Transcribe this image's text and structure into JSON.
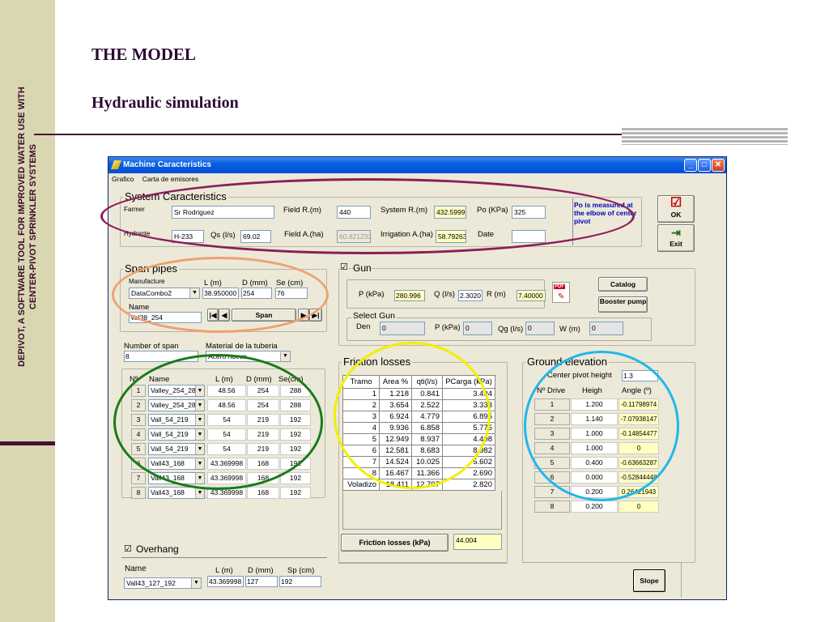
{
  "slide": {
    "side_text_line1": "DEPIVOT, A SOFTWARE TOOL FOR IMPROVED WATER USE WITH",
    "side_text_line2": "CENTER-PIVOT SPRINKLER SYSTEMS",
    "title": "THE MODEL",
    "subtitle": "Hydraulic simulation"
  },
  "window": {
    "title": "Machine Caracteristics",
    "menu": [
      "Grafico",
      "Carta de emisores"
    ],
    "buttons": {
      "minimize": "_",
      "maximize": "□",
      "close": "✕"
    }
  },
  "system": {
    "group_title": "System Caracteristics",
    "farmer_label": "Farmer",
    "farmer_value": "Sr Rodriguez",
    "hydrante_label": "Hydrante",
    "hydrante_value": "H-233",
    "field_r_label": "Field R.(m)",
    "field_r_value": "440",
    "system_r_label": "System R.(m)",
    "system_r_value": "432.5999",
    "po_label": "Po (KPa)",
    "po_value": "325",
    "qs_label": "Qs (l/s)",
    "qs_value": "69.02",
    "field_a_label": "Field A.(ha)",
    "field_a_value": "60.821233",
    "irrigation_label": "Irrigation A.(ha)",
    "irrigation_value": "58.79263",
    "date_label": "Date",
    "date_value": "",
    "note": "Po is measured at the elbow of center pivot"
  },
  "actions": {
    "ok": "OK",
    "exit": "Exit",
    "ok_icon": "checkbox-check-icon",
    "exit_icon": "exit-door-icon"
  },
  "span_pipes": {
    "group_title": "Span pipes",
    "manufacture_label": "Manufacture",
    "manufacture_value": "DataCombo2",
    "l_label": "L (m)",
    "l_value": "38.950000",
    "d_label": "D (mm)",
    "d_value": "254",
    "se_label": "Se (cm)",
    "se_value": "76",
    "name_label": "Name",
    "name_value": "Val38_254",
    "span_button": "Span",
    "nav_first": "|◀",
    "nav_prev": "◀",
    "nav_next": "▶",
    "nav_last": "▶|"
  },
  "spans": {
    "number_label": "Number of span",
    "number_value": "8",
    "material_label": "Material de la tuberia",
    "material_value": "Acero nuevo",
    "headers": [
      "Nº",
      "Name",
      "L (m)",
      "D (mm)",
      "Se(cm)"
    ],
    "rows": [
      {
        "n": "1",
        "name": "Valley_254_28",
        "l": "48.56",
        "d": "254",
        "se": "288"
      },
      {
        "n": "2",
        "name": "Valley_254_28",
        "l": "48.56",
        "d": "254",
        "se": "288"
      },
      {
        "n": "3",
        "name": "Vall_54_219",
        "l": "54",
        "d": "219",
        "se": "192"
      },
      {
        "n": "4",
        "name": "Vall_54_219",
        "l": "54",
        "d": "219",
        "se": "192"
      },
      {
        "n": "5",
        "name": "Vall_54_219",
        "l": "54",
        "d": "219",
        "se": "192"
      },
      {
        "n": "6",
        "name": "Vall43_168",
        "l": "43.369998",
        "d": "168",
        "se": "192"
      },
      {
        "n": "7",
        "name": "Vall43_168",
        "l": "43.369998",
        "d": "168",
        "se": "192"
      },
      {
        "n": "8",
        "name": "Vall43_168",
        "l": "43.369998",
        "d": "168",
        "se": "192"
      }
    ]
  },
  "overhang": {
    "label": "Overhang",
    "checked": true,
    "headers": [
      "Name",
      "L (m)",
      "D (mm)",
      "Sp (cm)"
    ],
    "name_value": "Vall43_127_192",
    "l_value": "43.369998",
    "d_value": "127",
    "sp_value": "192"
  },
  "gun": {
    "label": "Gun",
    "checked": true,
    "p_label": "P (kPa)",
    "p_value": "280.996",
    "q_label": "Q (l/s)",
    "q_value": "2.3020",
    "r_label": "R (m)",
    "r_value": "7.40000",
    "catalog_button": "Catalog",
    "booster_button": "Booster pump",
    "pdf_icon": "pdf-document-icon",
    "select_title": "Select Gun",
    "den_label": "Den",
    "den_value": "0",
    "sp_label": "P (kPa)",
    "sp_value": "0",
    "qg_label": "Qg (l/s)",
    "qg_value": "0",
    "w_label": "W (m)",
    "w_value": "0"
  },
  "friction": {
    "group_title": "Friction losses",
    "headers": [
      "Tramo",
      "Area %",
      "qti(l/s)",
      "PCarga (kPa)"
    ],
    "rows": [
      {
        "tramo": "1",
        "area": "1.218",
        "qti": "0.841",
        "pc": "3.494"
      },
      {
        "tramo": "2",
        "area": "3.654",
        "qti": "2.522",
        "pc": "3.333"
      },
      {
        "tramo": "3",
        "area": "6.924",
        "qti": "4.779",
        "pc": "6.895"
      },
      {
        "tramo": "4",
        "area": "9.936",
        "qti": "6.858",
        "pc": "5.775"
      },
      {
        "tramo": "5",
        "area": "12.949",
        "qti": "8.937",
        "pc": "4.408"
      },
      {
        "tramo": "6",
        "area": "12.581",
        "qti": "8.683",
        "pc": "8.982"
      },
      {
        "tramo": "7",
        "area": "14.524",
        "qti": "10.025",
        "pc": "5.602"
      },
      {
        "tramo": "8",
        "area": "16.467",
        "qti": "11.366",
        "pc": "2.690"
      },
      {
        "tramo": "Voladizo",
        "area": "18.411",
        "qti": "12.707",
        "pc": "2.820"
      }
    ],
    "total_button": "Friction losses  (kPa)",
    "total_value": "44.004"
  },
  "ground": {
    "group_title": "Ground elevation",
    "center_label": "Center pivot height",
    "center_value": "1.3",
    "headers": [
      "Nº Drive",
      "Heigh",
      "Angle (º)"
    ],
    "rows": [
      {
        "n": "1",
        "h": "1.200",
        "a": "-0.11798974"
      },
      {
        "n": "2",
        "h": "1.140",
        "a": "-7.07938147"
      },
      {
        "n": "3",
        "h": "1.000",
        "a": "-0.14854477"
      },
      {
        "n": "4",
        "h": "1.000",
        "a": "0"
      },
      {
        "n": "5",
        "h": "0.400",
        "a": "-0.63663287"
      },
      {
        "n": "6",
        "h": "0.000",
        "a": "-0.52844448"
      },
      {
        "n": "7",
        "h": "0.200",
        "a": "0.26421943"
      },
      {
        "n": "8",
        "h": "0.200",
        "a": "0"
      }
    ],
    "slope_button": "Slope"
  },
  "annotations": {
    "system_ring_color": "#8b1e5a",
    "span_ring_color": "#f0a070",
    "spans_ring_color": "#1a7a1a",
    "friction_ring_color": "#f0f000",
    "ground_ring_color": "#22b8e8"
  }
}
